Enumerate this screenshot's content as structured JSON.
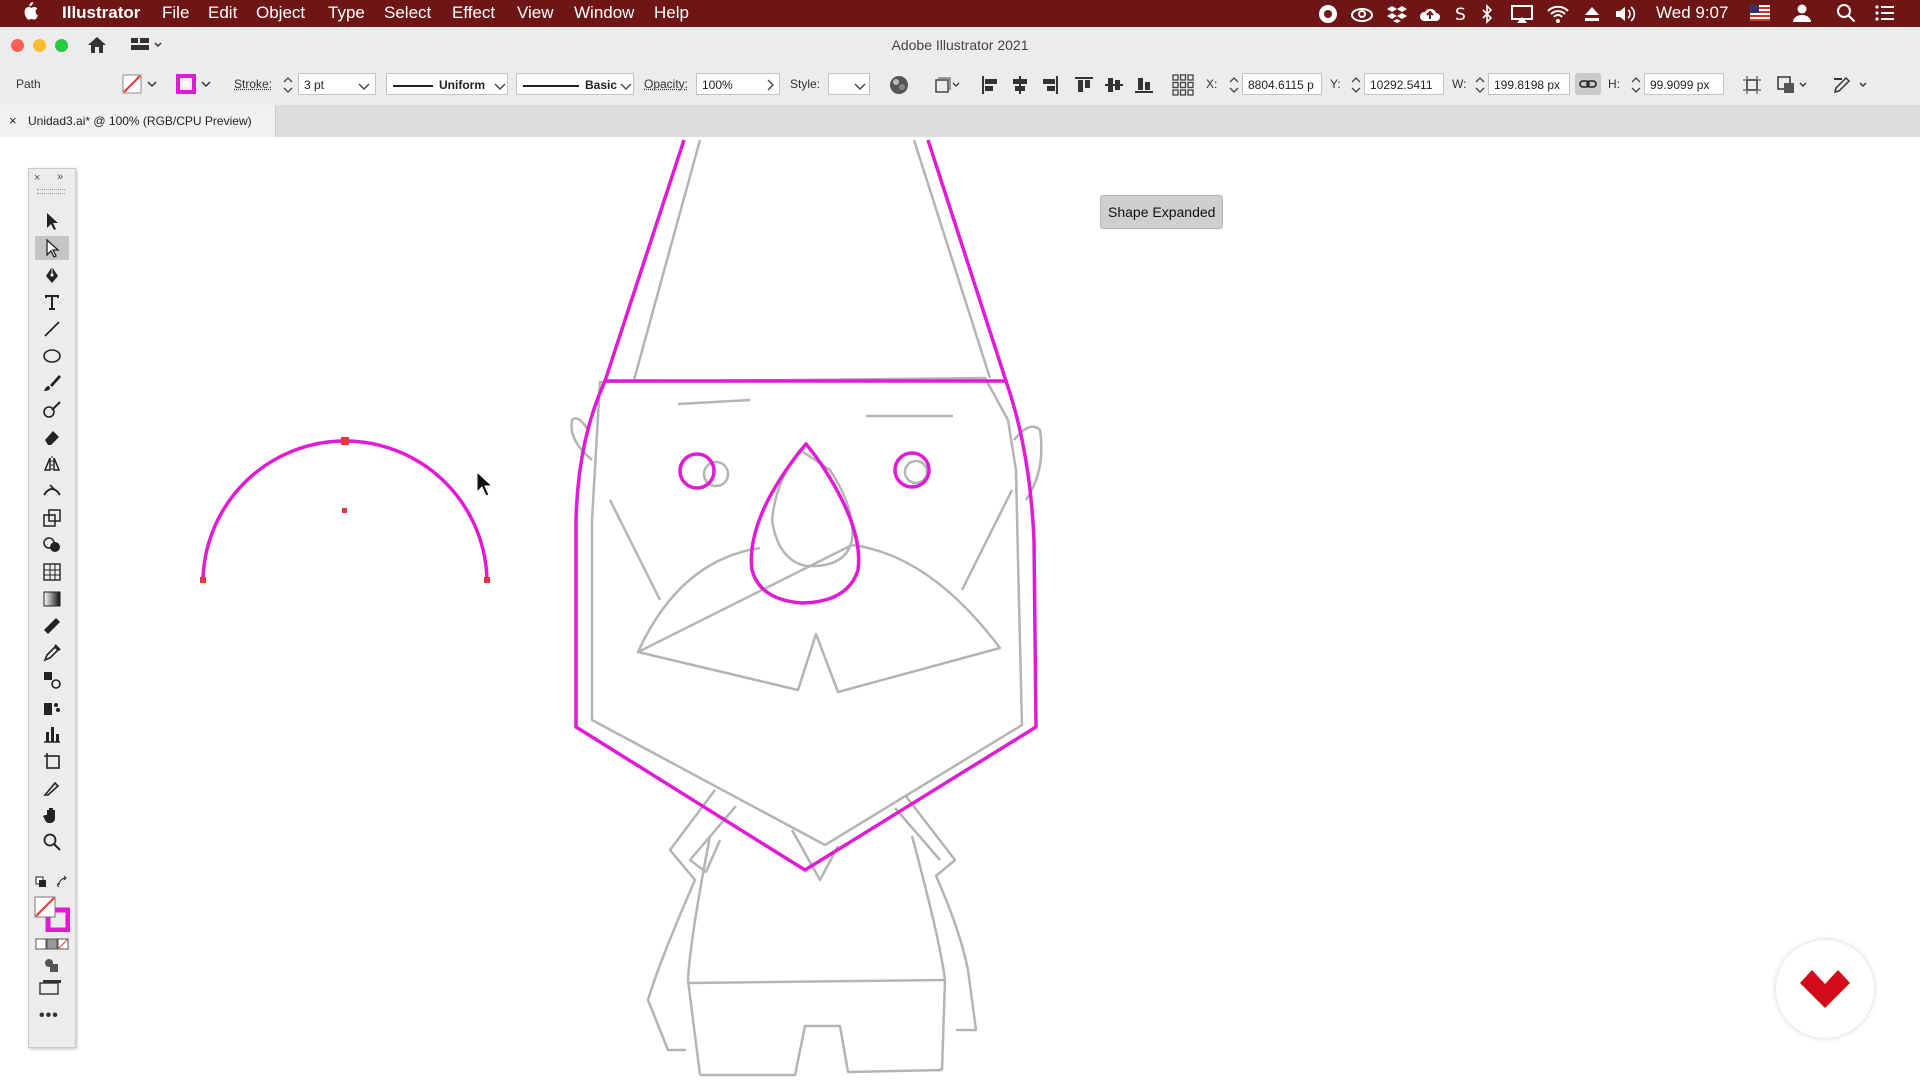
{
  "menubar": {
    "apple_icon": "apple-logo",
    "app_name": "Illustrator",
    "items": [
      "File",
      "Edit",
      "Object",
      "Type",
      "Select",
      "Effect",
      "View",
      "Window",
      "Help"
    ],
    "clock": "Wed 9:07",
    "bg_color": "#6e1515"
  },
  "window": {
    "title": "Adobe Illustrator 2021"
  },
  "control_bar": {
    "selection_type": "Path",
    "stroke_label": "Stroke:",
    "stroke_weight": "3 pt",
    "stroke_profile": "Uniform",
    "brush": "Basic",
    "opacity_label": "Opacity:",
    "opacity_value": "100%",
    "style_label": "Style:",
    "x_label": "X:",
    "x_value": "8804.6115 p",
    "y_label": "Y:",
    "y_value": "10292.5411",
    "w_label": "W:",
    "w_value": "199.8198 px",
    "h_label": "H:",
    "h_value": "99.9099 px",
    "stroke_color": "#e11ad6"
  },
  "document_tab": {
    "close": "×",
    "title": "Unidad3.ai* @ 100% (RGB/CPU Preview)"
  },
  "tooltip": {
    "text": "Shape Expanded"
  },
  "colors": {
    "selection": "#e11ad6",
    "artwork": "#b4b4b4",
    "anchor": "#e8343c"
  },
  "tools": [
    "selection-tool",
    "direct-selection-tool",
    "pen-tool",
    "type-tool",
    "line-segment-tool",
    "ellipse-tool",
    "paintbrush-tool",
    "shaper-tool",
    "eraser-tool",
    "reflect-tool",
    "width-tool",
    "scale-tool",
    "shape-builder-tool",
    "perspective-grid-tool",
    "gradient-tool",
    "measure-tool",
    "eyedropper-tool",
    "blend-tool",
    "symbol-sprayer-tool",
    "column-graph-tool",
    "artboard-tool",
    "slice-tool",
    "hand-tool",
    "zoom-tool"
  ]
}
